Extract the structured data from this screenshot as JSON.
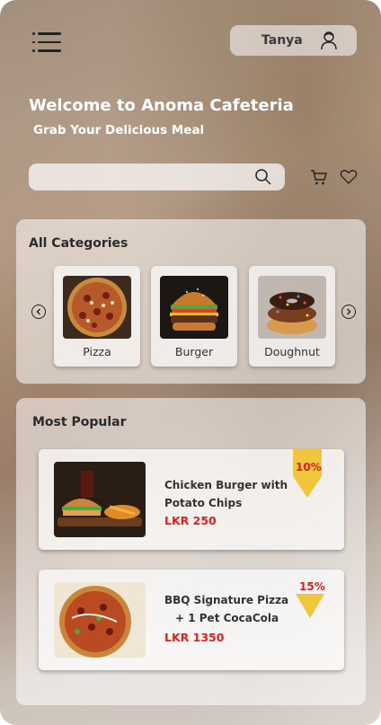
{
  "header": {
    "user_name": "Tanya",
    "welcome": "Welcome to Anoma Cafeteria",
    "subtitle": "Grab Your Delicious Meal"
  },
  "search": {
    "placeholder": ""
  },
  "icons": {
    "menu": "menu-icon",
    "user": "user-icon",
    "search": "search-icon",
    "cart": "cart-icon",
    "favorite": "heart-icon",
    "prev": "chevron-left-icon",
    "next": "chevron-right-icon"
  },
  "categories": {
    "title": "All Categories",
    "items": [
      {
        "label": "Pizza"
      },
      {
        "label": "Burger"
      },
      {
        "label": "Doughnut"
      }
    ]
  },
  "popular": {
    "title": "Most Popular",
    "items": [
      {
        "name_line1": "Chicken Burger with",
        "name_line2": "Potato Chips",
        "price": "LKR 250",
        "discount": "10%"
      },
      {
        "name_line1": "BBQ Signature Pizza",
        "name_line2": "+  1 Pet CocaCola",
        "price": "LKR 1350",
        "discount": "15%"
      }
    ]
  },
  "colors": {
    "price": "#e0201e",
    "discount_flag": "#f0c63d",
    "discount_text": "#d62020"
  }
}
